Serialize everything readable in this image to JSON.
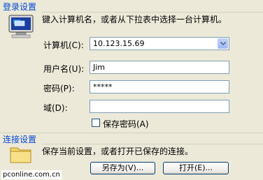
{
  "login_section": {
    "title": "登录设置",
    "description": "键入计算机名，或者从下拉表中选择一台计算机。",
    "computer_label": "计算机(C):",
    "computer_value": "10.123.15.69",
    "username_label": "用户名(U):",
    "username_value": "Jim",
    "password_label": "密码(P):",
    "password_value": "*****",
    "domain_label": "域(D):",
    "domain_value": "",
    "save_password_label": "保存密码(A)",
    "save_password_checked": false
  },
  "connection_section": {
    "title": "连接设置",
    "description": "保存当前设置，或者打开已保存的连接。",
    "save_as_label": "另存为(V)...",
    "open_label": "打开(E)..."
  },
  "watermark": "pconline.com.cn",
  "icons": {
    "login": "computer-icon",
    "connection": "folder-icon",
    "combo": "chevron-down-icon"
  }
}
